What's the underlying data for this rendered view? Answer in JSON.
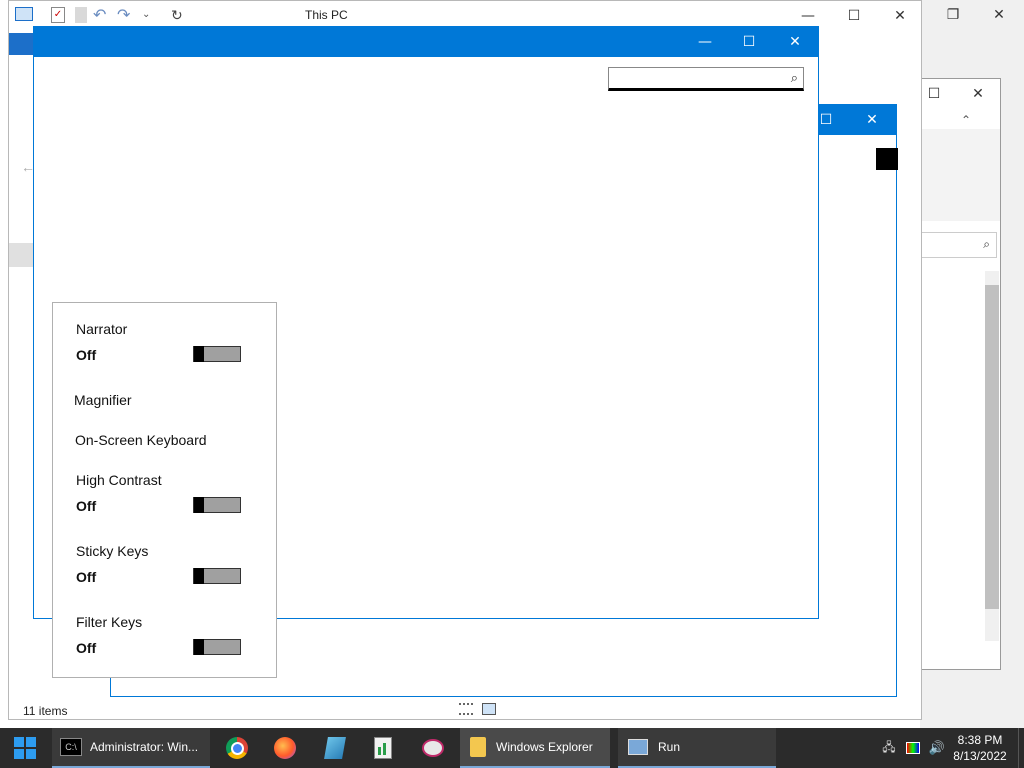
{
  "explorer_back": {
    "title": "This PC",
    "status_items": "11 items",
    "minimize": "—",
    "maximize": "☐",
    "close": "✕"
  },
  "explorer_right": {
    "restore": "❐",
    "close": "✕",
    "help": "?"
  },
  "explorer_right2": {
    "maximize": "☐",
    "close": "✕"
  },
  "blue_window_top": {
    "minimize": "—",
    "maximize": "☐",
    "close": "✕"
  },
  "blue_window_mid": {
    "maximize": "☐",
    "close": "✕"
  },
  "accessibility": {
    "narrator_label": "Narrator",
    "narrator_state": "Off",
    "magnifier_label": "Magnifier",
    "osk_label": "On-Screen Keyboard",
    "high_contrast_label": "High Contrast",
    "high_contrast_state": "Off",
    "sticky_keys_label": "Sticky Keys",
    "sticky_keys_state": "Off",
    "filter_keys_label": "Filter Keys",
    "filter_keys_state": "Off"
  },
  "taskbar": {
    "cmd_label": "Administrator: Win...",
    "explorer_label": "Windows Explorer",
    "run_label": "Run",
    "time": "8:38 PM",
    "date": "8/13/2022"
  },
  "colors": {
    "accent": "#0078d7",
    "taskbar": "#2b2b2b"
  }
}
